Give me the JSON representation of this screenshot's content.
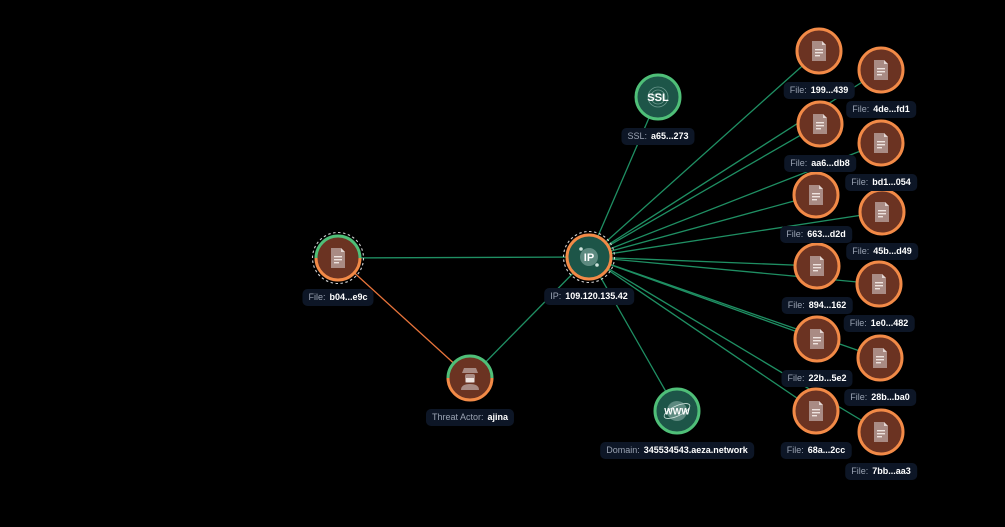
{
  "colors": {
    "background": "#000000",
    "edge_link": "#1f8f63",
    "edge_actor": "#e8743b",
    "file_fill": "#6b3322",
    "file_ring": "#f28a47",
    "infra_fill": "#1d5548",
    "infra_ring": "#4fbf78",
    "label_bg": "#0d1626"
  },
  "nodes": [
    {
      "id": "file_b04",
      "type": "file",
      "key": "File:",
      "value": "b04...e9c",
      "icon": "document-icon",
      "selected": true,
      "ring": "split"
    },
    {
      "id": "ip",
      "type": "ip",
      "key": "IP:",
      "value": "109.120.135.42",
      "icon": "ip-icon",
      "selected": true,
      "ring": "orange"
    },
    {
      "id": "actor",
      "type": "threat-actor",
      "key": "Threat Actor:",
      "value": "ajina",
      "icon": "spy-icon",
      "ring": "split"
    },
    {
      "id": "ssl",
      "type": "ssl",
      "key": "SSL:",
      "value": "a65...273",
      "icon": "fingerprint-ssl-icon",
      "ring": "green"
    },
    {
      "id": "domain",
      "type": "domain",
      "key": "Domain:",
      "value": "345534543.aeza.network",
      "icon": "globe-www-icon",
      "ring": "green"
    },
    {
      "id": "f199",
      "type": "file",
      "key": "File:",
      "value": "199...439",
      "icon": "document-icon",
      "ring": "orange"
    },
    {
      "id": "f4de",
      "type": "file",
      "key": "File:",
      "value": "4de...fd1",
      "icon": "document-icon",
      "ring": "orange"
    },
    {
      "id": "faa6",
      "type": "file",
      "key": "File:",
      "value": "aa6...db8",
      "icon": "document-icon",
      "ring": "orange"
    },
    {
      "id": "fbd1",
      "type": "file",
      "key": "File:",
      "value": "bd1...054",
      "icon": "document-icon",
      "ring": "orange"
    },
    {
      "id": "f663",
      "type": "file",
      "key": "File:",
      "value": "663...d2d",
      "icon": "document-icon",
      "ring": "orange"
    },
    {
      "id": "f45b",
      "type": "file",
      "key": "File:",
      "value": "45b...d49",
      "icon": "document-icon",
      "ring": "orange"
    },
    {
      "id": "f894",
      "type": "file",
      "key": "File:",
      "value": "894...162",
      "icon": "document-icon",
      "ring": "orange"
    },
    {
      "id": "f1e0",
      "type": "file",
      "key": "File:",
      "value": "1e0...482",
      "icon": "document-icon",
      "ring": "orange"
    },
    {
      "id": "f22b",
      "type": "file",
      "key": "File:",
      "value": "22b...5e2",
      "icon": "document-icon",
      "ring": "orange"
    },
    {
      "id": "f28b",
      "type": "file",
      "key": "File:",
      "value": "28b...ba0",
      "icon": "document-icon",
      "ring": "orange"
    },
    {
      "id": "f68a",
      "type": "file",
      "key": "File:",
      "value": "68a...2cc",
      "icon": "document-icon",
      "ring": "orange"
    },
    {
      "id": "f7bb",
      "type": "file",
      "key": "File:",
      "value": "7bb...aa3",
      "icon": "document-icon",
      "ring": "orange"
    }
  ],
  "edges": [
    {
      "from": "file_b04",
      "to": "ip",
      "kind": "link"
    },
    {
      "from": "file_b04",
      "to": "actor",
      "kind": "actor"
    },
    {
      "from": "actor",
      "to": "ip",
      "kind": "link"
    },
    {
      "from": "ip",
      "to": "ssl",
      "kind": "link"
    },
    {
      "from": "ip",
      "to": "domain",
      "kind": "link"
    },
    {
      "from": "ip",
      "to": "f199",
      "kind": "link"
    },
    {
      "from": "ip",
      "to": "f4de",
      "kind": "link"
    },
    {
      "from": "ip",
      "to": "faa6",
      "kind": "link"
    },
    {
      "from": "ip",
      "to": "fbd1",
      "kind": "link"
    },
    {
      "from": "ip",
      "to": "f663",
      "kind": "link"
    },
    {
      "from": "ip",
      "to": "f45b",
      "kind": "link"
    },
    {
      "from": "ip",
      "to": "f894",
      "kind": "link"
    },
    {
      "from": "ip",
      "to": "f1e0",
      "kind": "link"
    },
    {
      "from": "ip",
      "to": "f22b",
      "kind": "link"
    },
    {
      "from": "ip",
      "to": "f28b",
      "kind": "link"
    },
    {
      "from": "ip",
      "to": "f68a",
      "kind": "link"
    },
    {
      "from": "ip",
      "to": "f7bb",
      "kind": "link"
    }
  ]
}
